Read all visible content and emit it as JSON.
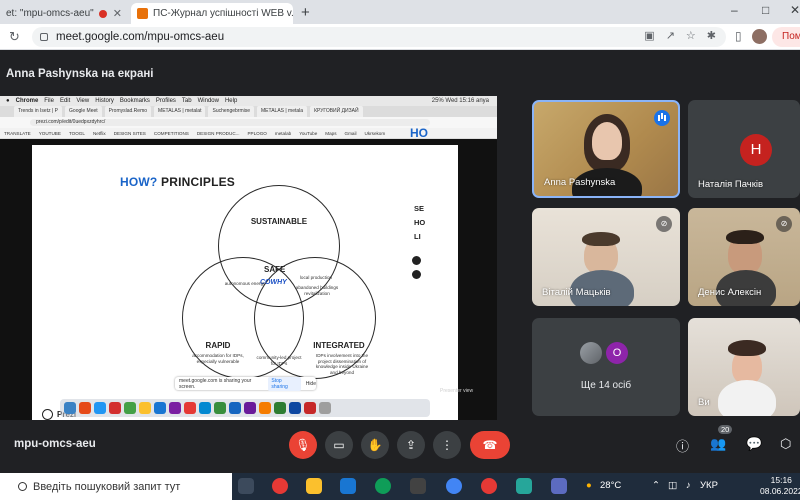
{
  "browser": {
    "tabs": [
      {
        "title": "et: \"mpu-omcs-aeu\"",
        "recording": true
      },
      {
        "title": "ПС-Журнал успішності WEB v.3",
        "active": true
      }
    ],
    "new_tab": "+",
    "window_controls": {
      "minimize": "–",
      "maximize": "□",
      "close": "✕"
    },
    "address": "meet.google.com/mpu-omcs-aeu",
    "update_button": "Поми"
  },
  "meet": {
    "presenter_banner": "Anna Pashynska на екрані",
    "meeting_code": "mpu-omcs-aeu",
    "participant_count": "20"
  },
  "presentation": {
    "menubar": {
      "app": "Chrome",
      "items": [
        "File",
        "Edit",
        "View",
        "History",
        "Bookmarks",
        "Profiles",
        "Tab",
        "Window",
        "Help"
      ],
      "status": "25%   Wed 15:16   anya"
    },
    "inner_tabs": [
      "Trends in Isetz | P",
      "Google Meet",
      "Promyslad.Remo",
      "METALAS | metalat",
      "Suchengebrmise",
      "METALAS | metala",
      "КРУГОВИЙ ДИЗАЙ"
    ],
    "inner_url": "prezi.com/p/edit/0uedpxzdyhrc/",
    "bookmarks": [
      "TRANSLATE",
      "YOUTUBE",
      "TOOGL",
      "Netflix",
      "DESIGN SITES",
      "COMPETITIONS",
      "DESIGN PRODUC...",
      "PPLOGO",
      "metalab",
      "YouTube",
      "Maps",
      "Gmail",
      "Ukrsekom"
    ],
    "slide": {
      "title_how": "HOW?",
      "title_rest": " PRINCIPLES",
      "sustainable": "SUSTAINABLE",
      "rapid": "RAPID",
      "integrated": "INTEGRATED",
      "safe": "SAFE",
      "cowhy": "COWHY",
      "autonomous": "autonomous energy",
      "local_production": "local production",
      "abandoned": "abandoned buildings revitalization",
      "rapid_desc": "accommodation for IDPs, especially vulnerable",
      "community": "community-led project for IDPs",
      "integrated_desc": "IDPs involvement into the project dissemination of knowledge inside Ukraine and beyond",
      "brand": "Prezi",
      "peek_title": "HO",
      "peek_lines": [
        "SE",
        "HO",
        "LI"
      ]
    },
    "share_banner": {
      "text": "meet.google.com is sharing your screen.",
      "stop": "Stop sharing",
      "hide": "Hide"
    },
    "presenter_view": "Presenter view"
  },
  "participants": [
    {
      "name": "Anna Pashynska",
      "speaking": true
    },
    {
      "name": "Наталія Пачків",
      "initial": "Н",
      "color": "#c5221f"
    },
    {
      "name": "Віталій Мацьків",
      "muted": true
    },
    {
      "name": "Денис Алексін",
      "muted": true
    },
    {
      "name": "Ще 14 осіб",
      "extra_initial": "О",
      "color": "#8e24aa"
    },
    {
      "name": "Ви"
    }
  ],
  "taskbar": {
    "search_placeholder": "Введіть пошуковий запит тут",
    "temperature": "28°C",
    "language": "УКР",
    "time": "15:16",
    "date": "08.06.2022"
  },
  "colors": {
    "meet_bg": "#202124",
    "tile_bg": "#3c4043",
    "end_call": "#ea4335",
    "accent": "#1a73e8",
    "slide_blue": "#1a64c8"
  }
}
